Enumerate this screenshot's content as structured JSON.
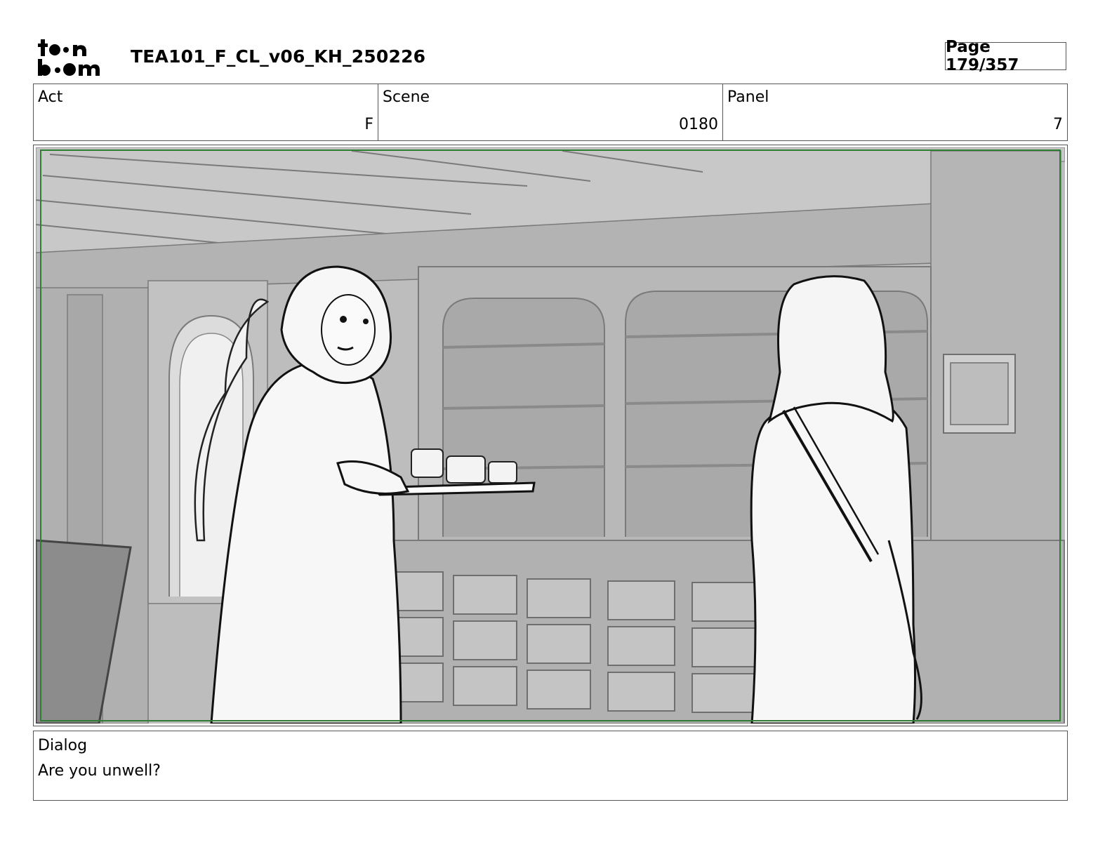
{
  "header": {
    "logo_text_top": "toon",
    "logo_text_bottom": "boom",
    "doc_title": "TEA101_F_CL_v06_KH_250226",
    "page_label": "Page 179/357"
  },
  "info": {
    "act_label": "Act",
    "act_value": "F",
    "scene_label": "Scene",
    "scene_value": "0180",
    "panel_label": "Panel",
    "panel_value": "7"
  },
  "panel": {
    "safe_frame_color": "#2e7d32",
    "background_gray": "#bdbdbd"
  },
  "dialog": {
    "label": "Dialog",
    "text": "Are you unwell?"
  }
}
